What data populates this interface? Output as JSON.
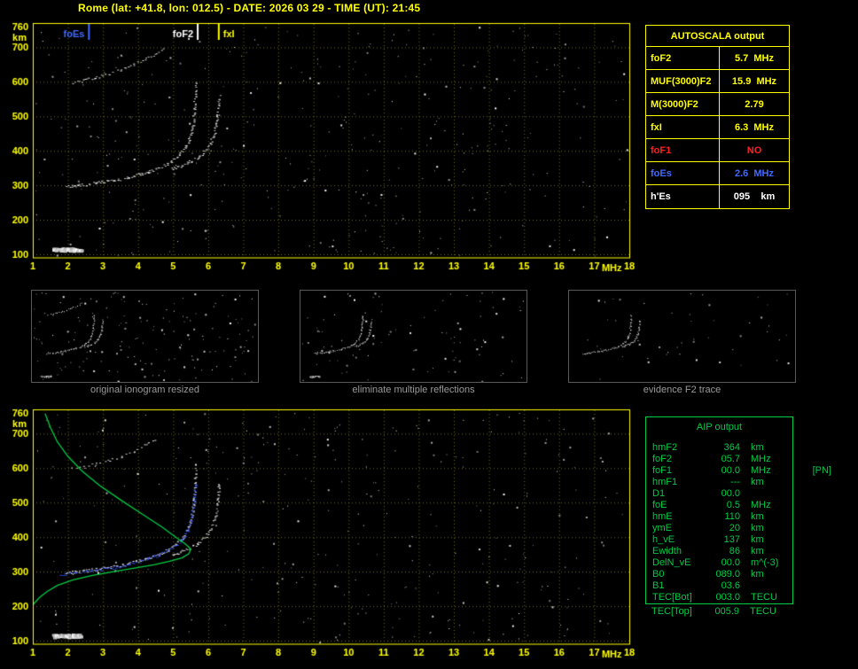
{
  "header": {
    "title": "Rome (lat: +41.8, lon: 012.5) - DATE: 2026 03 29 - TIME (UT): 21:45"
  },
  "colors": {
    "background": "#000000",
    "axis_yellow": "#ffff00",
    "grid_olive": "#6e6e00",
    "trace_white": "#ffffff",
    "autoscaled_blue": "#3253ff",
    "profile_green": "#00cc44",
    "alert_red": "#ff2020",
    "foes_blue": "#4169ff",
    "caption_gray": "#9a9a9a"
  },
  "autoscala_table": {
    "title": "AUTOSCALA output",
    "rows": [
      {
        "label": "foF2",
        "value": "5.7  MHz",
        "color": "#ffff00"
      },
      {
        "label": "MUF(3000)F2",
        "value": "15.9  MHz",
        "color": "#ffff00"
      },
      {
        "label": "M(3000)F2",
        "value": "2.79",
        "color": "#ffff00"
      },
      {
        "label": "fxI",
        "value": "6.3  MHz",
        "color": "#ffff00"
      },
      {
        "label": "foF1",
        "value": "NO",
        "color": "#ff2020"
      },
      {
        "label": "foEs",
        "value": "2.6  MHz",
        "color": "#4169ff"
      },
      {
        "label": "h'Es",
        "value": "095    km",
        "color": "#ffffff"
      }
    ]
  },
  "aip_table": {
    "title": "AIP output",
    "rows": [
      {
        "label": "hmF2",
        "value": "364",
        "unit": "km",
        "extra": ""
      },
      {
        "label": "foF2",
        "value": "05.7",
        "unit": "MHz",
        "extra": ""
      },
      {
        "label": "foF1",
        "value": "00.0",
        "unit": "MHz",
        "extra": "[PN]"
      },
      {
        "label": "hmF1",
        "value": "---",
        "unit": "km",
        "extra": ""
      },
      {
        "label": "D1",
        "value": "00.0",
        "unit": "",
        "extra": ""
      },
      {
        "label": "foE",
        "value": "0.5",
        "unit": "MHz",
        "extra": ""
      },
      {
        "label": "hmE",
        "value": "110",
        "unit": "km",
        "extra": ""
      },
      {
        "label": "ymE",
        "value": "20",
        "unit": "km",
        "extra": ""
      },
      {
        "label": "h_vE",
        "value": "137",
        "unit": "km",
        "extra": ""
      },
      {
        "label": "Ewidth",
        "value": "86",
        "unit": "km",
        "extra": ""
      },
      {
        "label": "DelN_vE",
        "value": "00.0",
        "unit": "m^(-3)",
        "extra": ""
      },
      {
        "label": "B0",
        "value": "089.0",
        "unit": "km",
        "extra": ""
      },
      {
        "label": "B1",
        "value": "03.6",
        "unit": "",
        "extra": ""
      },
      {
        "label": "TEC[Bot]",
        "value": "003.0",
        "unit": "TECU",
        "extra": ""
      }
    ],
    "footer_row": {
      "label": "TEC[Top]",
      "value": "005.9",
      "unit": "TECU",
      "extra": ""
    }
  },
  "thumbnails": [
    {
      "caption": "original ionogram resized",
      "series": [
        "F2-ordinary",
        "F2-extraordinary",
        "multiple-hop",
        "agc-blob"
      ],
      "noise_count": 170,
      "seed": 31
    },
    {
      "caption": "eliminate multiple reflections",
      "series": [
        "F2-ordinary",
        "F2-extraordinary",
        "agc-blob"
      ],
      "noise_count": 95,
      "seed": 47
    },
    {
      "caption": "evidence F2 trace",
      "series": [
        "F2-ordinary",
        "F2-extraordinary"
      ],
      "noise_count": 50,
      "seed": 59
    }
  ],
  "chart_data": [
    {
      "id": "main-ionogram",
      "type": "scatter",
      "title": "recorded ionogram with AUTOSCALA characteristic markers",
      "xlabel": "MHz",
      "ylabel": "km",
      "xlim": [
        1,
        18
      ],
      "ylim": [
        100,
        760
      ],
      "xticks": [
        1,
        2,
        3,
        4,
        5,
        6,
        7,
        8,
        9,
        10,
        11,
        12,
        13,
        14,
        15,
        16,
        17,
        18
      ],
      "yticks": [
        100,
        200,
        300,
        400,
        500,
        600,
        700,
        760
      ],
      "grid": true,
      "legend": [
        {
          "label": "foEs",
          "freq": 2.6,
          "color": "#4169ff"
        },
        {
          "label": "foF2",
          "freq": 5.7,
          "color": "#ffffff"
        },
        {
          "label": "fxI",
          "freq": 6.3,
          "color": "#ffff00"
        }
      ],
      "series": [
        {
          "name": "F2-ordinary",
          "color": "#ffffff",
          "vary": true,
          "size": 2,
          "density": 1,
          "points": [
            [
              1.95,
              298
            ],
            [
              2.2,
              300
            ],
            [
              2.5,
              303
            ],
            [
              2.8,
              307
            ],
            [
              3.1,
              312
            ],
            [
              3.4,
              317
            ],
            [
              3.7,
              323
            ],
            [
              4.0,
              331
            ],
            [
              4.3,
              340
            ],
            [
              4.6,
              351
            ],
            [
              4.85,
              363
            ],
            [
              5.05,
              377
            ],
            [
              5.2,
              392
            ],
            [
              5.32,
              408
            ],
            [
              5.42,
              427
            ],
            [
              5.5,
              450
            ],
            [
              5.55,
              477
            ],
            [
              5.58,
              505
            ],
            [
              5.6,
              535
            ],
            [
              5.62,
              568
            ],
            [
              5.63,
              598
            ]
          ]
        },
        {
          "name": "F2-extraordinary",
          "color": "#ffffff",
          "vary": true,
          "size": 2,
          "density": 1,
          "points": [
            [
              4.95,
              348
            ],
            [
              5.2,
              357
            ],
            [
              5.45,
              369
            ],
            [
              5.7,
              383
            ],
            [
              5.9,
              401
            ],
            [
              6.05,
              423
            ],
            [
              6.15,
              448
            ],
            [
              6.22,
              477
            ],
            [
              6.26,
              508
            ],
            [
              6.29,
              540
            ],
            [
              6.3,
              558
            ]
          ]
        },
        {
          "name": "multiple-hop",
          "color": "#c8c8c8",
          "vary": true,
          "size": 2,
          "density": 0.6,
          "points": [
            [
              2.1,
              598
            ],
            [
              2.45,
              605
            ],
            [
              2.8,
              613
            ],
            [
              3.15,
              623
            ],
            [
              3.5,
              635
            ],
            [
              3.85,
              650
            ],
            [
              4.2,
              666
            ],
            [
              4.5,
              682
            ],
            [
              4.7,
              694
            ]
          ]
        },
        {
          "name": "agc-blob",
          "color": "#ffffff",
          "vary": true,
          "size": 4,
          "density": 3,
          "points": [
            [
              1.55,
              116
            ],
            [
              2.35,
              116
            ]
          ]
        }
      ],
      "noise": {
        "count": 380,
        "seed": 7
      }
    },
    {
      "id": "restored-ionogram",
      "type": "scatter",
      "title": "restored ionogram with autoscaled trace and electron density profile",
      "xlabel": "MHz",
      "ylabel": "km",
      "xlim": [
        1,
        18
      ],
      "ylim": [
        100,
        760
      ],
      "xticks": [
        1,
        2,
        3,
        4,
        5,
        6,
        7,
        8,
        9,
        10,
        11,
        12,
        13,
        14,
        15,
        16,
        17,
        18
      ],
      "yticks": [
        100,
        200,
        300,
        400,
        500,
        600,
        700,
        760
      ],
      "grid": true,
      "legend": [],
      "series": [
        {
          "name": "F2-ordinary",
          "color": "#ffffff",
          "vary": true,
          "size": 2,
          "density": 1,
          "points": [
            [
              1.95,
              298
            ],
            [
              2.2,
              300
            ],
            [
              2.5,
              303
            ],
            [
              2.8,
              307
            ],
            [
              3.1,
              312
            ],
            [
              3.4,
              317
            ],
            [
              3.7,
              323
            ],
            [
              4.0,
              331
            ],
            [
              4.3,
              340
            ],
            [
              4.6,
              351
            ],
            [
              4.85,
              363
            ],
            [
              5.05,
              377
            ],
            [
              5.2,
              392
            ],
            [
              5.32,
              408
            ],
            [
              5.42,
              427
            ],
            [
              5.5,
              450
            ],
            [
              5.55,
              477
            ],
            [
              5.58,
              505
            ],
            [
              5.6,
              535
            ],
            [
              5.62,
              568
            ],
            [
              5.63,
              598
            ]
          ]
        },
        {
          "name": "F2-extraordinary",
          "color": "#ffffff",
          "vary": true,
          "size": 2,
          "density": 1,
          "points": [
            [
              4.95,
              348
            ],
            [
              5.2,
              357
            ],
            [
              5.45,
              369
            ],
            [
              5.7,
              383
            ],
            [
              5.9,
              401
            ],
            [
              6.05,
              423
            ],
            [
              6.15,
              448
            ],
            [
              6.22,
              477
            ],
            [
              6.26,
              508
            ],
            [
              6.29,
              540
            ],
            [
              6.3,
              558
            ]
          ]
        },
        {
          "name": "multiple-hop",
          "color": "#bbbbbb",
          "vary": true,
          "size": 2,
          "density": 0.4,
          "points": [
            [
              2.1,
              598
            ],
            [
              2.45,
              605
            ],
            [
              2.8,
              613
            ],
            [
              3.15,
              623
            ],
            [
              3.5,
              635
            ],
            [
              3.85,
              650
            ],
            [
              4.2,
              666
            ],
            [
              4.5,
              682
            ]
          ]
        },
        {
          "name": "agc-blob",
          "color": "#ffffff",
          "vary": true,
          "size": 4,
          "density": 3,
          "points": [
            [
              1.55,
              116
            ],
            [
              2.35,
              116
            ]
          ]
        },
        {
          "name": "autoscaled-trace",
          "color": "#3253ff",
          "size": 2,
          "density": 1.1,
          "points": [
            [
              1.8,
              291
            ],
            [
              2.1,
              296
            ],
            [
              2.5,
              301
            ],
            [
              2.9,
              306
            ],
            [
              3.3,
              313
            ],
            [
              3.7,
              321
            ],
            [
              4.1,
              332
            ],
            [
              4.5,
              346
            ],
            [
              4.8,
              359
            ],
            [
              5.05,
              375
            ],
            [
              5.25,
              394
            ],
            [
              5.4,
              418
            ],
            [
              5.5,
              448
            ],
            [
              5.56,
              482
            ],
            [
              5.6,
              520
            ],
            [
              5.62,
              556
            ]
          ]
        },
        {
          "name": "electron-density-profile",
          "color": "#00cc44",
          "line": true,
          "points": [
            [
              1.35,
              758
            ],
            [
              1.5,
              718
            ],
            [
              1.7,
              676
            ],
            [
              2.0,
              634
            ],
            [
              2.4,
              592
            ],
            [
              2.9,
              550
            ],
            [
              3.5,
              508
            ],
            [
              4.1,
              468
            ],
            [
              4.7,
              428
            ],
            [
              5.1,
              398
            ],
            [
              5.35,
              380
            ],
            [
              5.5,
              366
            ],
            [
              5.45,
              352
            ],
            [
              5.25,
              340
            ],
            [
              4.9,
              330
            ],
            [
              4.45,
              320
            ],
            [
              3.9,
              310
            ],
            [
              3.3,
              300
            ],
            [
              2.7,
              289
            ],
            [
              2.15,
              276
            ],
            [
              1.7,
              260
            ],
            [
              1.4,
              242
            ],
            [
              1.18,
              224
            ],
            [
              1.02,
              206
            ],
            [
              0.95,
              188
            ]
          ]
        }
      ],
      "noise": {
        "count": 320,
        "seed": 13
      }
    }
  ]
}
